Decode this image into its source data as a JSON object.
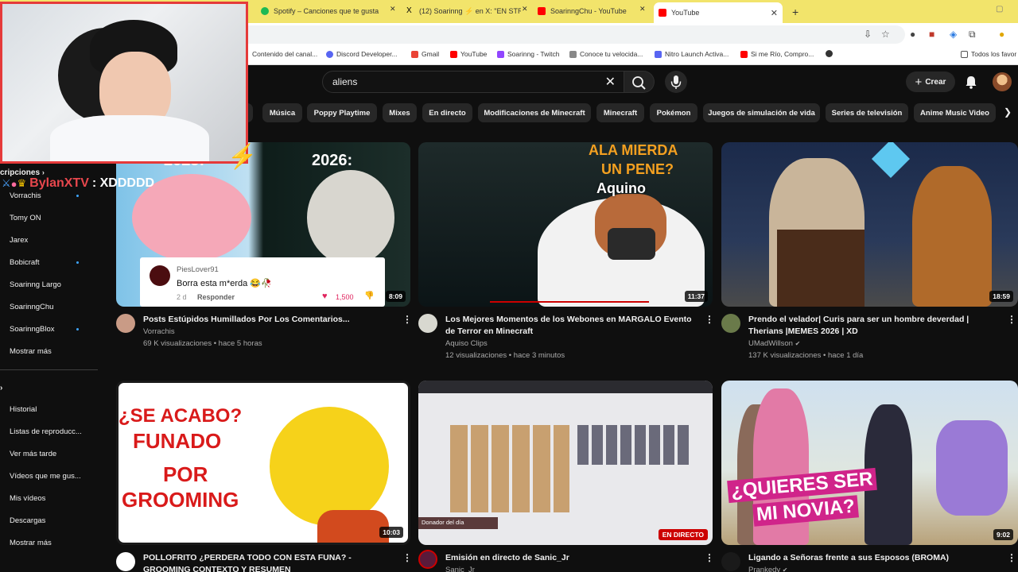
{
  "browser": {
    "tabs": [
      {
        "label": "Spotify – Canciones que te gusta",
        "color": "#1db954"
      },
      {
        "label": "(12) Soarinng ⚡ en X: \"EN STR",
        "color": "#000000"
      },
      {
        "label": "SoarinngChu - YouTube",
        "color": "#ff0000"
      },
      {
        "label": "YouTube",
        "color": "#ff0000"
      }
    ],
    "new_tab": "+",
    "bookmarks": [
      {
        "label": "Contenido del canal...",
        "color": "#ffffff"
      },
      {
        "label": "Discord Developer...",
        "color": "#5865f2"
      },
      {
        "label": "Gmail",
        "color": "#ea4335"
      },
      {
        "label": "YouTube",
        "color": "#ff0000"
      },
      {
        "label": "Soarinng - Twitch",
        "color": "#9146ff"
      },
      {
        "label": "Conoce tu velocida...",
        "color": "#888888"
      },
      {
        "label": "Nitro Launch Activa...",
        "color": "#5865f2"
      },
      {
        "label": "Si me Río, Compro...",
        "color": "#ff0000"
      }
    ],
    "all_bookmarks": "Todos los favor"
  },
  "header": {
    "search_value": "aliens",
    "create_label": "Crear"
  },
  "chips": [
    "Música",
    "Poppy Playtime",
    "Mixes",
    "En directo",
    "Modificaciones de Minecraft",
    "Minecraft",
    "Pokémon",
    "Juegos de simulación de vida",
    "Series de televisión",
    "Anime Music Video"
  ],
  "sidebar": {
    "subs_heading": "cripciones",
    "subscriptions": [
      {
        "label": "Vorrachis",
        "dot": true
      },
      {
        "label": "Tomy ON",
        "dot": false
      },
      {
        "label": "Jarex",
        "dot": false
      },
      {
        "label": "Bobicraft",
        "dot": true
      },
      {
        "label": "Soarinng Largo",
        "dot": false
      },
      {
        "label": "SoarinngChu",
        "dot": false
      },
      {
        "label": "SoarinngBlox",
        "dot": true
      }
    ],
    "show_more_1": "Mostrar más",
    "you_items": [
      "Historial",
      "Listas de reproducc...",
      "Ver más tarde",
      "Vídeos que me gus...",
      "Mis vídeos",
      "Descargas"
    ],
    "show_more_2": "Mostrar más"
  },
  "stream_overlay": {
    "chat_user": "BylanXTV",
    "chat_message": ": XDDDDD"
  },
  "videos": [
    {
      "title": "Posts Estúpidos Humillados Por Los Comentarios...",
      "channel": "Vorrachis",
      "meta": "69 K visualizaciones • hace 5 horas",
      "duration": "8:09",
      "thumb_text": [
        "2025:",
        "2026:"
      ],
      "comment": {
        "user": "PiesLover91",
        "text": "Borra esta m*erda 😂🥀",
        "age": "2 d",
        "reply": "Responder",
        "likes": "1,500"
      }
    },
    {
      "title": "Los Mejores Momentos de los Webones en MARGALO Evento de Terror en Minecraft",
      "channel": "Aquiso Clips",
      "meta": "12 visualizaciones • hace 3 minutos",
      "duration": "11:37",
      "thumb_text": [
        "ALA MIERDA",
        "UN PENE?",
        "Aquino"
      ]
    },
    {
      "title": "Prendo el velador| Curis para ser un hombre deverdad | Therians |MEMES 2026 | XD",
      "channel": "UMadWillson",
      "meta": "137 K visualizaciones • hace 1 día",
      "duration": "18:59",
      "thumb_text": []
    },
    {
      "title": "POLLOFRITO ¿PERDERA TODO CON ESTA FUNA? - GROOMING CONTEXTO Y RESUMEN",
      "channel": "",
      "meta": "",
      "duration": "10:03",
      "thumb_text": [
        "¿SE ACABO?",
        "FUNADO",
        "POR",
        "GROOMING"
      ]
    },
    {
      "title": "Emisión en directo de Sanic_Jr",
      "channel": "Sanic_Jr",
      "meta": "",
      "duration": "EN DIRECTO",
      "thumb_text": [
        "Donador del día"
      ]
    },
    {
      "title": "Ligando a Señoras frente a sus Esposos (BROMA)",
      "channel": "Prankedy",
      "meta": "",
      "duration": "9:02",
      "thumb_text": [
        "¿QUIERES SER",
        "MI NOVIA?"
      ]
    }
  ]
}
